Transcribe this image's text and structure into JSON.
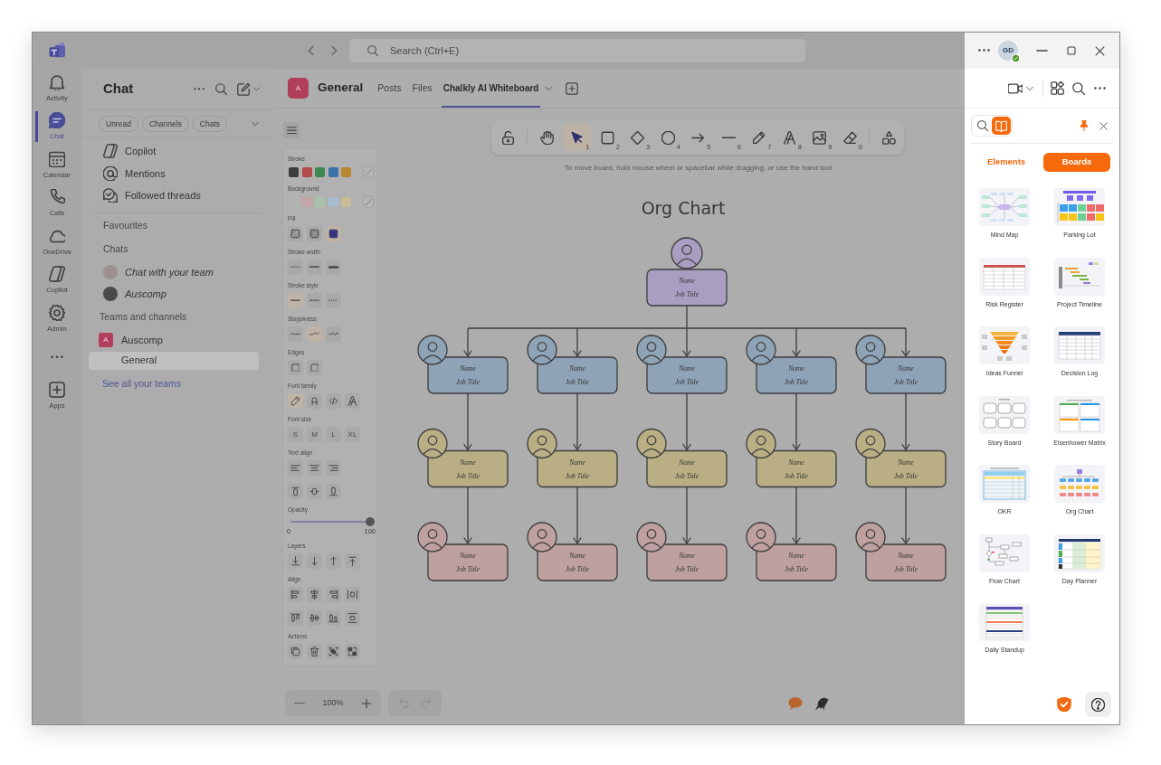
{
  "title_bar": {
    "search_placeholder": "Search (Ctrl+E)",
    "account_initials": "GD"
  },
  "app_rail": [
    {
      "kind": "app",
      "label": "Activity",
      "selected": false
    },
    {
      "kind": "app",
      "label": "Chat",
      "selected": true
    },
    {
      "kind": "app",
      "label": "Calendar",
      "selected": false
    },
    {
      "kind": "app",
      "label": "Calls",
      "selected": false
    },
    {
      "kind": "app",
      "label": "OneDrive",
      "selected": false
    },
    {
      "kind": "app",
      "label": "Copilot",
      "selected": false
    },
    {
      "kind": "app",
      "label": "Admin",
      "selected": false
    },
    {
      "kind": "more",
      "selected": false
    },
    {
      "kind": "app",
      "label": "Apps",
      "selected": false
    }
  ],
  "chat_panel": {
    "title": "Chat",
    "filters": [
      {
        "label": "Unread",
        "selected": false
      },
      {
        "label": "Channels",
        "selected": false
      },
      {
        "label": "Chats",
        "selected": false
      }
    ],
    "quick_links": [
      {
        "label": "Copilot"
      },
      {
        "label": "Mentions"
      },
      {
        "label": "Followed threads"
      }
    ],
    "favourites_heading": "Favourites",
    "chats_heading": "Chats",
    "chats": [
      {
        "label": "Chat with your team"
      },
      {
        "label": "Auscomp"
      }
    ],
    "teams_heading": "Teams and channels",
    "teams": [
      {
        "name": "Auscomp",
        "initial": "A",
        "channels": [
          {
            "label": "General",
            "selected": true
          }
        ]
      }
    ],
    "see_all_link": "See all your teams"
  },
  "channel_header": {
    "team_initial": "A",
    "channel": "General",
    "tabs": [
      {
        "label": "Posts",
        "selected": false
      },
      {
        "label": "Files",
        "selected": false
      },
      {
        "label": "Chalkly AI Whiteboard",
        "selected": true
      }
    ]
  },
  "whiteboard": {
    "tools": [
      {
        "selected": false
      },
      {
        "key": "1",
        "selected": true
      },
      {
        "key": "2",
        "selected": false
      },
      {
        "key": "3",
        "selected": false
      },
      {
        "key": "4",
        "selected": false
      },
      {
        "key": "5",
        "selected": false
      },
      {
        "key": "6",
        "selected": false
      },
      {
        "key": "7",
        "selected": false
      },
      {
        "key": "8",
        "selected": false
      },
      {
        "key": "9",
        "selected": false
      },
      {
        "key": "0",
        "selected": false
      }
    ],
    "hint": "To move board, hold mouse wheel or spacebar while dragging, or use the hand tool",
    "properties": [
      {
        "label": "Stroke",
        "kind": "swatches",
        "swatches": [
          {
            "kind": "color",
            "color": "#3d3d3d"
          },
          {
            "kind": "color",
            "color": "#b34a4a"
          },
          {
            "kind": "color",
            "color": "#3f8752"
          },
          {
            "kind": "color",
            "color": "#3b73a6"
          },
          {
            "kind": "color",
            "color": "#b7862f"
          }
        ]
      },
      {
        "label": "Background",
        "kind": "swatches",
        "swatches": [
          {
            "kind": "none"
          },
          {
            "kind": "color",
            "color": "#c4a6a6"
          },
          {
            "kind": "color",
            "color": "#a8c2a9"
          },
          {
            "kind": "color",
            "color": "#a7bccd"
          },
          {
            "kind": "color",
            "color": "#c6bc97"
          }
        ]
      },
      {
        "label": "Fill",
        "kind": "icons",
        "options": [
          {
            "selected": false
          },
          {
            "selected": false
          },
          {
            "selected": true
          }
        ]
      },
      {
        "label": "Stroke width",
        "kind": "icons",
        "options": [
          {
            "selected": false
          },
          {
            "selected": false
          },
          {
            "selected": false
          }
        ]
      },
      {
        "label": "Stroke style",
        "kind": "icons",
        "options": [
          {
            "selected": true
          },
          {
            "selected": false
          },
          {
            "selected": false
          }
        ]
      },
      {
        "label": "Sloppiness",
        "kind": "icons",
        "options": [
          {
            "selected": false
          },
          {
            "selected": true
          },
          {
            "selected": false
          }
        ]
      },
      {
        "label": "Edges",
        "kind": "icons",
        "options": [
          {
            "selected": false
          },
          {
            "selected": false
          }
        ]
      },
      {
        "label": "Font family",
        "kind": "icons",
        "options": [
          {
            "selected": true
          },
          {
            "selected": false
          },
          {
            "selected": false
          },
          {
            "selected": false
          }
        ]
      },
      {
        "label": "Font size",
        "kind": "text",
        "options": [
          {
            "text": "S",
            "selected": false
          },
          {
            "text": "M",
            "selected": false
          },
          {
            "text": "L",
            "selected": false
          },
          {
            "text": "XL",
            "selected": false
          }
        ]
      },
      {
        "label": "Text align",
        "kind": "icons",
        "options": [
          {
            "selected": false
          },
          {
            "selected": false
          },
          {
            "selected": false
          },
          {
            "selected": false
          },
          {
            "selected": false
          },
          {
            "selected": false
          }
        ]
      },
      {
        "label": "Opacity",
        "kind": "slider",
        "level": 1,
        "min_label": "0",
        "max_label": "100"
      },
      {
        "label": "Layers",
        "kind": "icons",
        "options": [
          {
            "selected": false
          },
          {
            "selected": false
          },
          {
            "selected": false
          },
          {
            "selected": false
          }
        ]
      },
      {
        "label": "Align",
        "kind": "icons",
        "options": [
          {
            "selected": false
          },
          {
            "selected": false
          },
          {
            "selected": false
          },
          {
            "selected": false
          },
          {
            "selected": false
          },
          {
            "selected": false
          },
          {
            "selected": false
          },
          {
            "selected": false
          }
        ]
      },
      {
        "label": "Actions",
        "kind": "icons",
        "options": [
          {
            "selected": false
          },
          {
            "selected": false
          },
          {
            "selected": false
          },
          {
            "selected": false
          }
        ]
      }
    ],
    "zoom": "100%",
    "undo": {
      "disabled": true
    },
    "redo": {
      "disabled": true
    },
    "org_chart": {
      "title": "Org Chart",
      "root": {
        "name": "Name",
        "job_title": "Job Title",
        "color": "#a99ec1",
        "children": [
          {
            "name": "Name",
            "job_title": "Job Title",
            "color": "#8ea3b6",
            "children": [
              {
                "name": "Name",
                "job_title": "Job Title",
                "color": "#b9ae84",
                "children": [
                  {
                    "name": "Name",
                    "job_title": "Job Title",
                    "color": "#bfa0a0"
                  }
                ]
              }
            ]
          },
          {
            "name": "Name",
            "job_title": "Job Title",
            "color": "#8ea3b6",
            "children": [
              {
                "name": "Name",
                "job_title": "Job Title",
                "color": "#b9ae84",
                "children": [
                  {
                    "name": "Name",
                    "job_title": "Job Title",
                    "color": "#bfa0a0"
                  }
                ]
              }
            ]
          },
          {
            "name": "Name",
            "job_title": "Job Title",
            "color": "#8ea3b6",
            "children": [
              {
                "name": "Name",
                "job_title": "Job Title",
                "color": "#b9ae84",
                "children": [
                  {
                    "name": "Name",
                    "job_title": "Job Title",
                    "color": "#bfa0a0"
                  }
                ]
              }
            ]
          },
          {
            "name": "Name",
            "job_title": "Job Title",
            "color": "#8ea3b6",
            "children": [
              {
                "name": "Name",
                "job_title": "Job Title",
                "color": "#b9ae84",
                "children": [
                  {
                    "name": "Name",
                    "job_title": "Job Title",
                    "color": "#bfa0a0"
                  }
                ]
              }
            ]
          },
          {
            "name": "Name",
            "job_title": "Job Title",
            "color": "#8ea3b6",
            "children": [
              {
                "name": "Name",
                "job_title": "Job Title",
                "color": "#b9ae84",
                "children": [
                  {
                    "name": "Name",
                    "job_title": "Job Title",
                    "color": "#bfa0a0"
                  }
                ]
              }
            ]
          }
        ]
      }
    }
  },
  "side_panel": {
    "modes": [
      {
        "selected": false
      },
      {
        "selected": true
      }
    ],
    "tabs": [
      {
        "label": "Elements",
        "selected": false
      },
      {
        "label": "Boards",
        "selected": true
      }
    ],
    "boards": [
      {
        "label": "Mind Map"
      },
      {
        "label": "Parking Lot"
      },
      {
        "label": "Risk Register"
      },
      {
        "label": "Project Timeline"
      },
      {
        "label": "Ideas Funnel"
      },
      {
        "label": "Decision Log"
      },
      {
        "label": "Story Board"
      },
      {
        "label": "Eisenhower Matrix"
      },
      {
        "label": "OKR"
      },
      {
        "label": "Org Chart"
      },
      {
        "label": "Flow Chart"
      },
      {
        "label": "Day Planner"
      },
      {
        "label": "Daily Standup"
      }
    ]
  }
}
